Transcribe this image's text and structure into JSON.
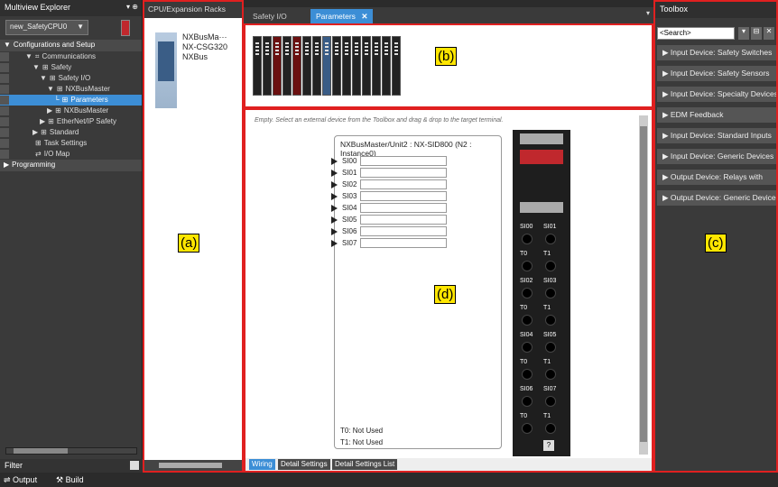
{
  "explorer": {
    "title": "Multiview Explorer",
    "title_controls": "▾ ⊕",
    "controller": "new_SafetyCPU0",
    "controller_arrow": "▼",
    "tree": [
      {
        "label": "Configurations and Setup",
        "indent": 0,
        "toggle": "▼",
        "icon": "",
        "header": true
      },
      {
        "label": "Communications",
        "indent": 1,
        "toggle": "▼",
        "icon": "⌗"
      },
      {
        "label": "Safety",
        "indent": 2,
        "toggle": "▼",
        "icon": "⊞"
      },
      {
        "label": "Safety I/O",
        "indent": 3,
        "toggle": "▼",
        "icon": "⊞"
      },
      {
        "label": "NXBusMaster",
        "indent": 4,
        "toggle": "▼",
        "icon": "⊞"
      },
      {
        "label": "Parameters",
        "indent": 5,
        "toggle": "└",
        "icon": "⊞",
        "selected": true
      },
      {
        "label": "NXBusMaster",
        "indent": 4,
        "toggle": "▶",
        "icon": "⊞"
      },
      {
        "label": "EtherNet/IP Safety",
        "indent": 3,
        "toggle": "▶",
        "icon": "⊞"
      },
      {
        "label": "Standard",
        "indent": 2,
        "toggle": "▶",
        "icon": "⊞"
      },
      {
        "label": "Task Settings",
        "indent": 2,
        "toggle": "",
        "icon": "⊞"
      },
      {
        "label": "I/O Map",
        "indent": 2,
        "toggle": "",
        "icon": "⇄"
      },
      {
        "label": "Programming",
        "indent": 0,
        "toggle": "▶",
        "icon": "",
        "header": true
      }
    ],
    "filter_label": "Filter",
    "filter_icon": "▼"
  },
  "racks": {
    "title": "CPU/Expansion Racks",
    "unit_lines": [
      "NXBusMa···",
      "NX-CSG320",
      "NXBus"
    ]
  },
  "tabs": [
    {
      "label": "Safety I/O",
      "active": false,
      "closable": false
    },
    {
      "label": "Parameters",
      "active": true,
      "closable": true,
      "close": "✕"
    }
  ],
  "tabs_menu": "▾",
  "editor": {
    "hint": "Empty. Select an external device from the Toolbox and drag & drop to the target terminal.",
    "unit_title": "NXBusMaster/Unit2 : NX-SID800 (N2 : Instance0)",
    "inputs": [
      "SI00",
      "SI01",
      "SI02",
      "SI03",
      "SI04",
      "SI05",
      "SI06",
      "SI07"
    ],
    "t0_status": "T0: Not Used",
    "t1_status": "T1: Not Used",
    "terminal_pairs": [
      [
        "SI00",
        "SI01"
      ],
      [
        "T0",
        "T1"
      ],
      [
        "SI02",
        "SI03"
      ],
      [
        "T0",
        "T1"
      ],
      [
        "SI04",
        "SI05"
      ],
      [
        "T0",
        "T1"
      ],
      [
        "SI06",
        "SI07"
      ],
      [
        "T0",
        "T1"
      ]
    ],
    "help": "?",
    "bottom_tabs": [
      {
        "label": "Wiring",
        "active": true
      },
      {
        "label": "Detail Settings",
        "active": false
      },
      {
        "label": "Detail Settings List",
        "active": false
      }
    ]
  },
  "toolbox": {
    "title": "Toolbox",
    "search": "<Search>",
    "items": [
      "Input Device: Safety Switches",
      "Input Device: Safety Sensors",
      "Input Device: Specialty Devices",
      "EDM Feedback",
      "Input Device: Standard Inputs",
      "Input Device: Generic Devices",
      "Output Device: Relays with",
      "Output Device: Generic Devices"
    ]
  },
  "labels": {
    "a": "(a)",
    "b": "(b)",
    "c": "(c)",
    "d": "(d)"
  },
  "statusbar": {
    "output": "Output",
    "build": "Build"
  },
  "colors": {
    "accent": "#3c8ed6",
    "highlight": "#e02020",
    "label_bg": "#ffe600"
  }
}
